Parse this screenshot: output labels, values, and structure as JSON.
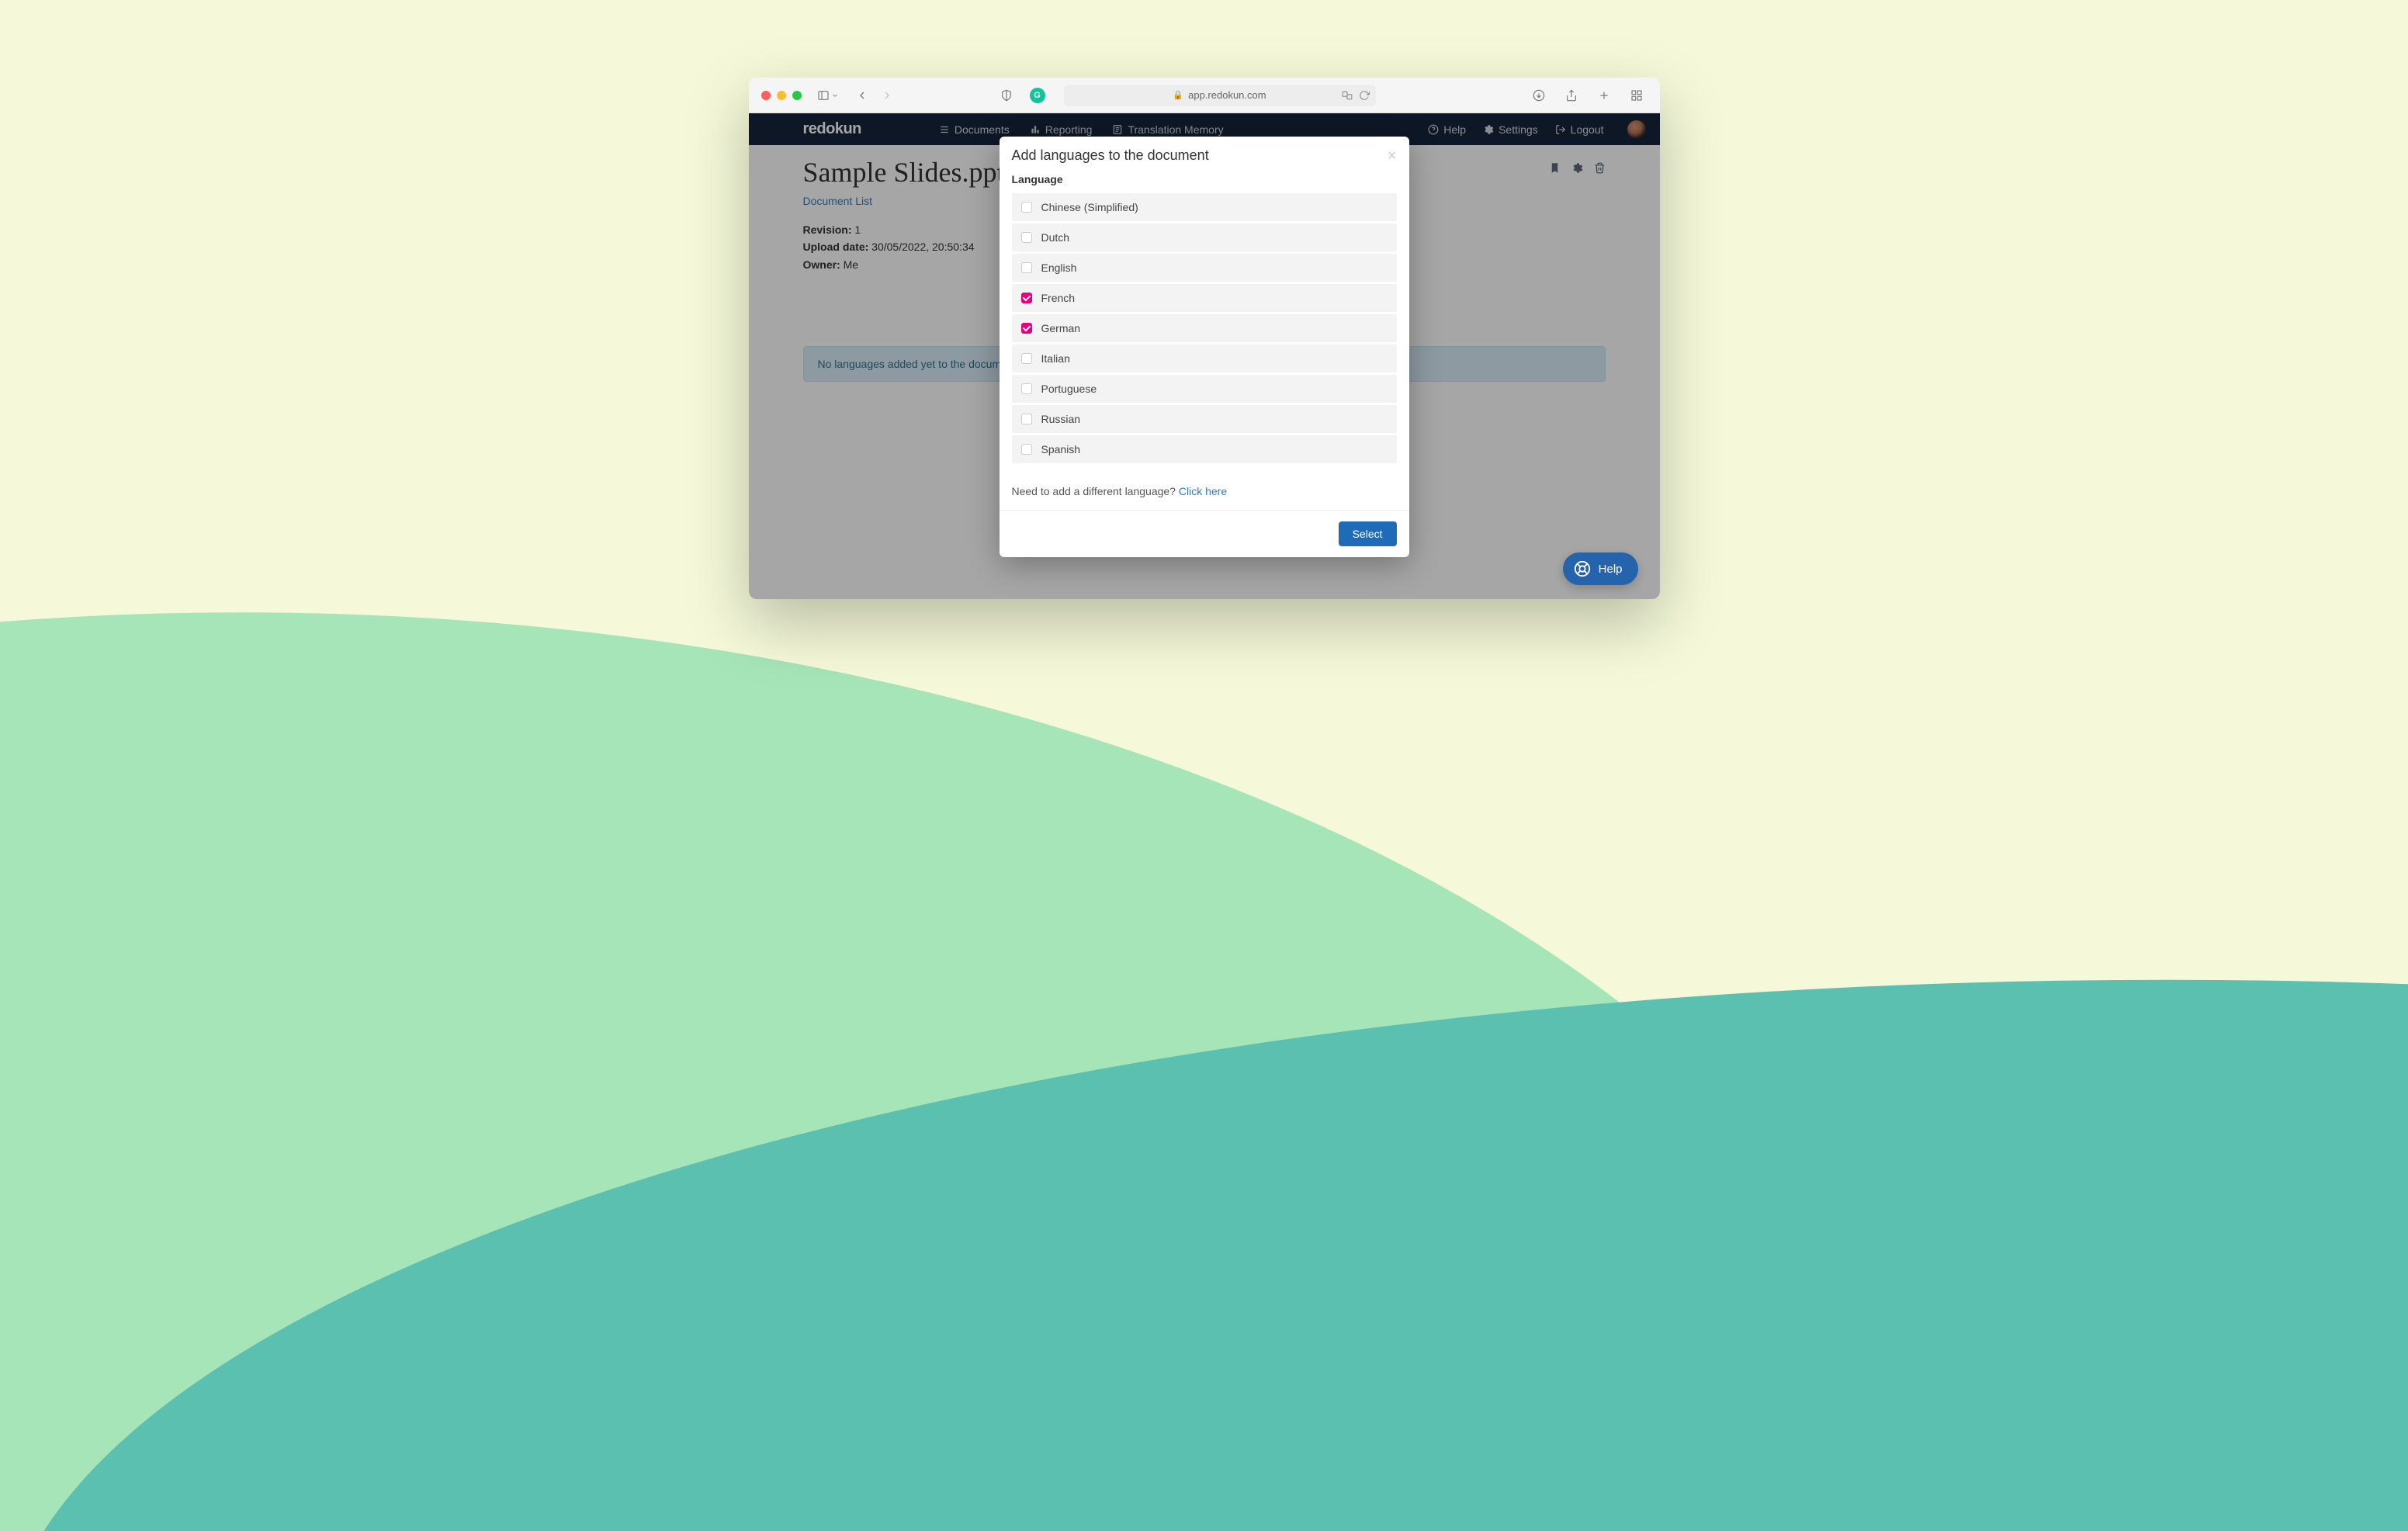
{
  "browser": {
    "url_host": "app.redokun.com"
  },
  "navbar": {
    "brand": "redokun",
    "items": [
      {
        "label": "Documents"
      },
      {
        "label": "Reporting"
      },
      {
        "label": "Translation Memory"
      }
    ],
    "right": {
      "help": "Help",
      "settings": "Settings",
      "logout": "Logout"
    }
  },
  "page": {
    "title": "Sample Slides.pptx",
    "breadcrumb": "Document List",
    "meta": {
      "revision_label": "Revision:",
      "revision_value": "1",
      "upload_label": "Upload date:",
      "upload_value": "30/05/2022, 20:50:34",
      "owner_label": "Owner:",
      "owner_value": "Me"
    },
    "info_banner": "No languages added yet to the document"
  },
  "modal": {
    "title": "Add languages to the document",
    "section_label": "Language",
    "languages": [
      {
        "name": "Chinese (Simplified)",
        "checked": false
      },
      {
        "name": "Dutch",
        "checked": false
      },
      {
        "name": "English",
        "checked": false
      },
      {
        "name": "French",
        "checked": true
      },
      {
        "name": "German",
        "checked": true
      },
      {
        "name": "Italian",
        "checked": false
      },
      {
        "name": "Portuguese",
        "checked": false
      },
      {
        "name": "Russian",
        "checked": false
      },
      {
        "name": "Spanish",
        "checked": false
      }
    ],
    "diff_lang_text": "Need to add a different language? ",
    "diff_lang_link": "Click here",
    "select_button": "Select"
  },
  "help_fab": {
    "label": "Help"
  }
}
